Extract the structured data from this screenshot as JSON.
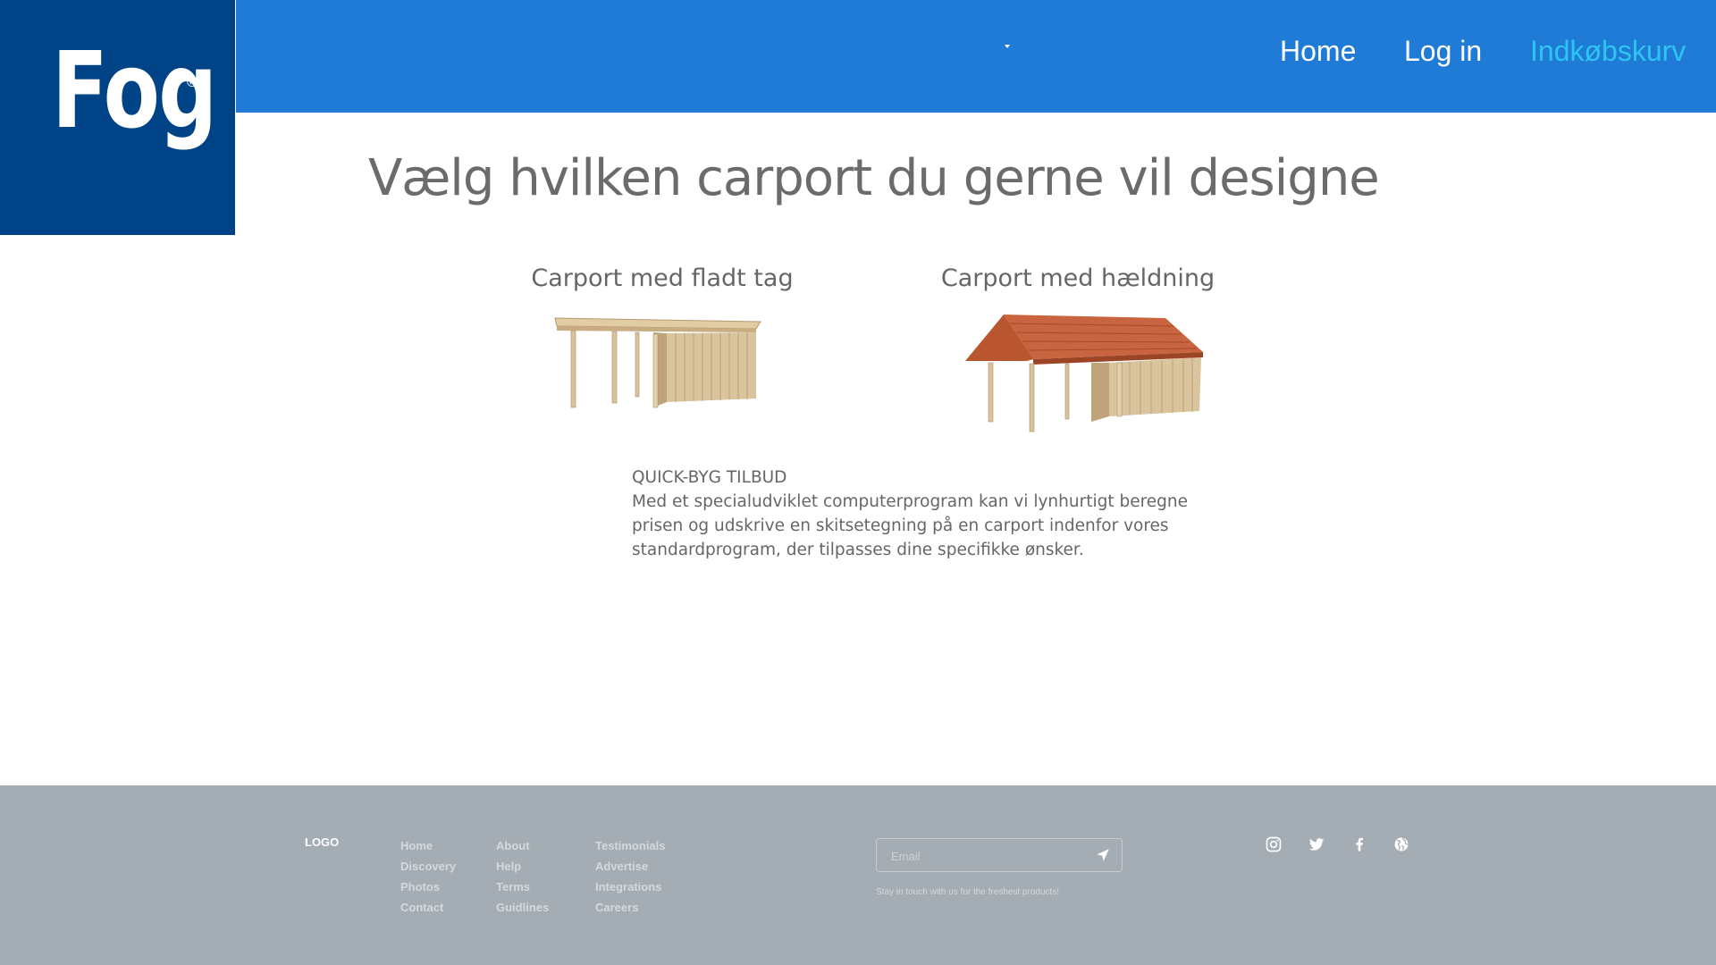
{
  "brand": {
    "logo_text": "Fog",
    "logo_mark": "®",
    "colors": {
      "header_bg": "#1f7bd6",
      "logo_bg": "#004386",
      "active_link": "#2ec5f0",
      "footer_bg": "#a4acb4"
    }
  },
  "nav": {
    "dropdown_icon": "caret-down-icon",
    "home": "Home",
    "login": "Log in",
    "cart": "Indkøbskurv"
  },
  "main": {
    "title": "Vælg hvilken carport du gerne vil designe",
    "cards": [
      {
        "title": "Carport med fladt tag",
        "image": "flat-roof-carport-image"
      },
      {
        "title": "Carport med hældning",
        "image": "pitched-roof-carport-image"
      }
    ],
    "info": {
      "heading": "QUICK-BYG TILBUD",
      "body": "Med et specialudviklet computerprogram kan vi lynhurtigt beregne prisen og udskrive en skitsetegning på en carport indenfor vores standardprogram, der tilpasses dine specifikke ønsker."
    }
  },
  "footer": {
    "logo": "LOGO",
    "columns": [
      [
        "Home",
        "Discovery",
        "Photos",
        "Contact"
      ],
      [
        "About",
        "Help",
        "Terms",
        "Guidlines"
      ],
      [
        "Testimonials",
        "Advertise",
        "Integrations",
        "Careers"
      ]
    ],
    "email_placeholder": "Email",
    "send_icon": "send-icon",
    "tagline": "Stay in touch with us for the freshest products!",
    "social_icons": [
      "instagram-icon",
      "twitter-icon",
      "facebook-icon",
      "globe-icon"
    ]
  }
}
